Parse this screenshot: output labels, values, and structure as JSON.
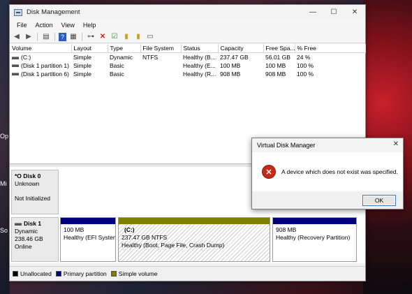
{
  "desktop": {
    "labels": [
      "Op",
      "Mi",
      "So"
    ]
  },
  "window": {
    "title": "Disk Management",
    "controls": {
      "minimize": "—",
      "maximize": "☐",
      "close": "✕"
    }
  },
  "menu": [
    "File",
    "Action",
    "View",
    "Help"
  ],
  "toolbar_icons": [
    "back-icon",
    "forward-icon",
    "console-icon",
    "help-icon",
    "properties-icon",
    "connect-icon",
    "delete-icon",
    "check-icon",
    "import-icon",
    "export-icon",
    "list-icon"
  ],
  "volume_table": {
    "headers": [
      "Volume",
      "Layout",
      "Type",
      "File System",
      "Status",
      "Capacity",
      "Free Spa...",
      "% Free"
    ],
    "rows": [
      [
        "(C:)",
        "Simple",
        "Dynamic",
        "NTFS",
        "Healthy (B...",
        "237.47 GB",
        "56.01 GB",
        "24 %"
      ],
      [
        "(Disk 1 partition 1)",
        "Simple",
        "Basic",
        "",
        "Healthy (E...",
        "100 MB",
        "100 MB",
        "100 %"
      ],
      [
        "(Disk 1 partition 6)",
        "Simple",
        "Basic",
        "",
        "Healthy (R...",
        "908 MB",
        "908 MB",
        "100 %"
      ]
    ]
  },
  "disks": {
    "disk0": {
      "name": "*O Disk 0",
      "type": "Unknown",
      "status": "Not Initialized"
    },
    "disk1": {
      "name": "Disk 1",
      "type": "Dynamic",
      "size": "238.46 GB",
      "status": "Online",
      "partitions": [
        {
          "line1": "100 MB",
          "line2": "Healthy (EFI System",
          "color": "#00007f"
        },
        {
          "line1": "(C:)",
          "line2": "237.47 GB NTFS",
          "line3": "Healthy (Boot, Page File, Crash Dump)",
          "color": "#7f7f00"
        },
        {
          "line1": "908 MB",
          "line2": "Healthy (Recovery Partition)",
          "color": "#00007f"
        }
      ]
    }
  },
  "legend": [
    {
      "label": "Unallocated",
      "color": "#000000"
    },
    {
      "label": "Primary partition",
      "color": "#00007f"
    },
    {
      "label": "Simple volume",
      "color": "#7f7f00"
    }
  ],
  "dialog": {
    "title": "Virtual Disk Manager",
    "close": "✕",
    "icon": "✕",
    "message": "A device which does not exist was specified.",
    "ok_label": "OK"
  }
}
